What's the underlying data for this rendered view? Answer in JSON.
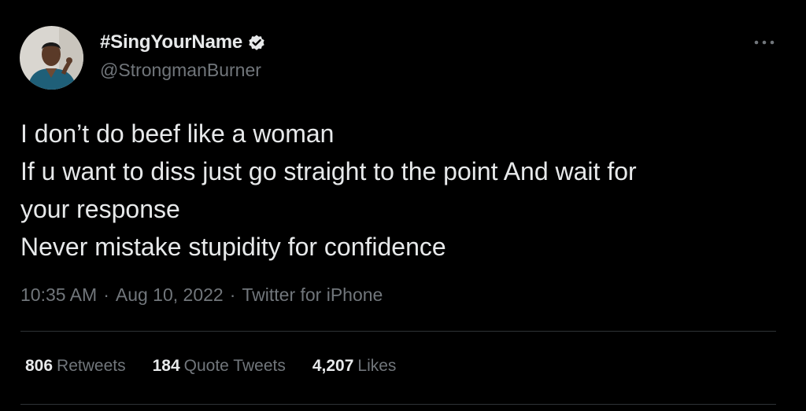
{
  "tweet": {
    "author": {
      "display_name": "#SingYourName",
      "handle": "@StrongmanBurner",
      "verified": true,
      "avatar_icon": "profile-photo",
      "verified_icon": "verified-badge-icon"
    },
    "text_lines": [
      "I don’t do beef like a woman",
      "If u want to diss just go straight to the point And wait for",
      "your response",
      "Never mistake stupidity for confidence"
    ],
    "meta": {
      "time": "10:35 AM",
      "separator": "·",
      "date": "Aug 10, 2022",
      "source": "Twitter for iPhone"
    },
    "stats": {
      "retweets": {
        "count": "806",
        "label": "Retweets"
      },
      "quote_tweets": {
        "count": "184",
        "label": "Quote Tweets"
      },
      "likes": {
        "count": "4,207",
        "label": "Likes"
      }
    },
    "more_icon": "more-options-icon"
  },
  "colors": {
    "background": "#000000",
    "primary_text": "#e7e9ea",
    "secondary_text": "#71767b",
    "divider": "#2f3336"
  }
}
